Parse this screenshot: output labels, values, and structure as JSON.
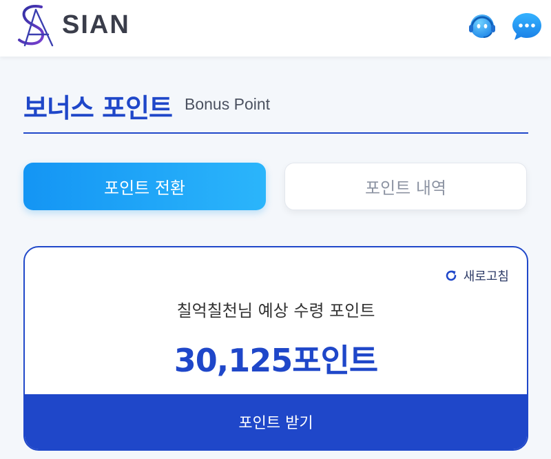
{
  "header": {
    "brand": "SIAN",
    "icons": [
      "support-agent-icon",
      "chat-bubble-icon"
    ]
  },
  "page": {
    "title": "보너스 포인트",
    "subtitle": "Bonus Point"
  },
  "tabs": [
    {
      "label": "포인트 전환",
      "active": true
    },
    {
      "label": "포인트 내역",
      "active": false
    }
  ],
  "card": {
    "refresh_label": "새로고침",
    "expected_label": "칠억칠천님 예상 수령 포인트",
    "points": "30,125포인트",
    "receive_button": "포인트 받기"
  },
  "colors": {
    "primary": "#1f47c9",
    "tab_gradient_start": "#1495f4",
    "tab_gradient_end": "#2bb5fb",
    "background": "#f4f7fb"
  }
}
